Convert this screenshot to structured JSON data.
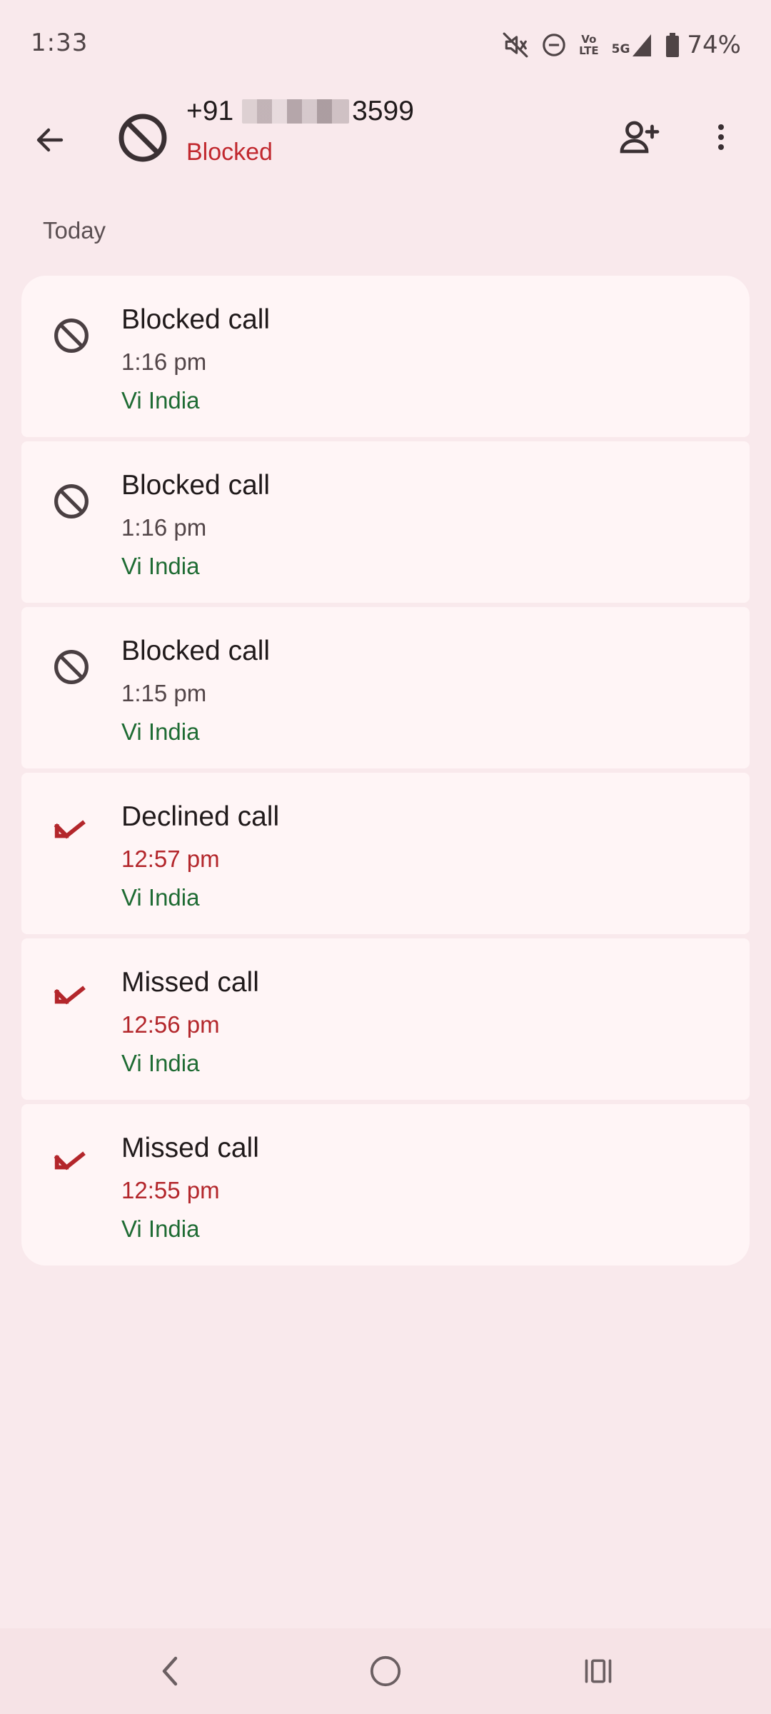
{
  "status_bar": {
    "time": "1:33",
    "lte_top": "Vo",
    "lte_bottom": "LTE",
    "network": "5G",
    "battery": "74%"
  },
  "contact": {
    "number_prefix": "+91",
    "number_suffix": "3599",
    "status": "Blocked"
  },
  "section": {
    "header": "Today"
  },
  "calls": [
    {
      "title": "Blocked call",
      "time": "1:16 pm",
      "carrier": "Vi India",
      "kind": "blocked"
    },
    {
      "title": "Blocked call",
      "time": "1:16 pm",
      "carrier": "Vi India",
      "kind": "blocked"
    },
    {
      "title": "Blocked call",
      "time": "1:15 pm",
      "carrier": "Vi India",
      "kind": "blocked"
    },
    {
      "title": "Declined call",
      "time": "12:57 pm",
      "carrier": "Vi India",
      "kind": "missed"
    },
    {
      "title": "Missed call",
      "time": "12:56 pm",
      "carrier": "Vi India",
      "kind": "missed"
    },
    {
      "title": "Missed call",
      "time": "12:55 pm",
      "carrier": "Vi India",
      "kind": "missed"
    }
  ],
  "colors": {
    "background": "#f9e9ec",
    "card": "#fff5f6",
    "blocked_red": "#c1282e",
    "missed_red": "#b3262b",
    "carrier_green": "#1e6b33"
  },
  "icons": {
    "back": "arrow-left-icon",
    "avatar": "block-icon",
    "add_contact": "person-add-icon",
    "more": "more-vert-icon",
    "blocked_call": "block-icon",
    "missed_call": "call-missed-icon"
  }
}
